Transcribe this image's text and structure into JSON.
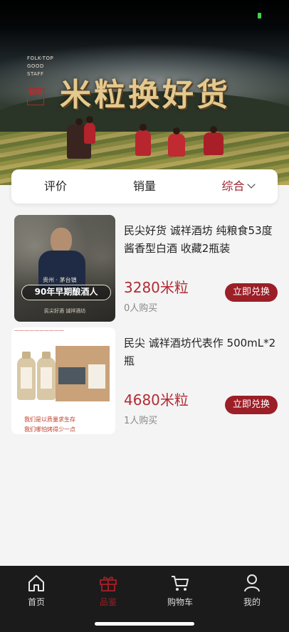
{
  "banner": {
    "brand_en_lines": [
      "FOLK-TOP",
      "GOOD",
      "STAFF"
    ],
    "seal_text": "民尖",
    "title": "米粒换好货"
  },
  "sort_tabs": [
    {
      "label": "评价",
      "active": false
    },
    {
      "label": "销量",
      "active": false
    },
    {
      "label": "综合",
      "active": true
    }
  ],
  "products": [
    {
      "title": "民尖好货 诚祥酒坊 纯粮食53度酱香型白酒 收藏2瓶装",
      "price": "3280米粒",
      "sold": "0人购买",
      "button": "立即兑换",
      "image": {
        "location": "贵州 · 茅台镇",
        "badge": "90年早期酿酒人",
        "footer": "民尖好酒  诚祥酒坊"
      }
    },
    {
      "title": "民尖 诚祥酒坊代表作 500mL*2瓶",
      "price": "4680米粒",
      "sold": "1人购买",
      "button": "立即兑换",
      "image": {
        "slogan1": "我们是以质量求生存",
        "slogan2": "我们哪怕烤得少一点"
      }
    }
  ],
  "tabbar": [
    {
      "label": "首页",
      "icon": "home-icon",
      "active": false
    },
    {
      "label": "品鉴",
      "icon": "gift-icon",
      "active": true
    },
    {
      "label": "购物车",
      "icon": "cart-icon",
      "active": false
    },
    {
      "label": "我的",
      "icon": "user-icon",
      "active": false
    }
  ],
  "colors": {
    "accent": "#9c1e26",
    "price": "#b22b34",
    "tabbar_bg": "#1b1b1b"
  }
}
